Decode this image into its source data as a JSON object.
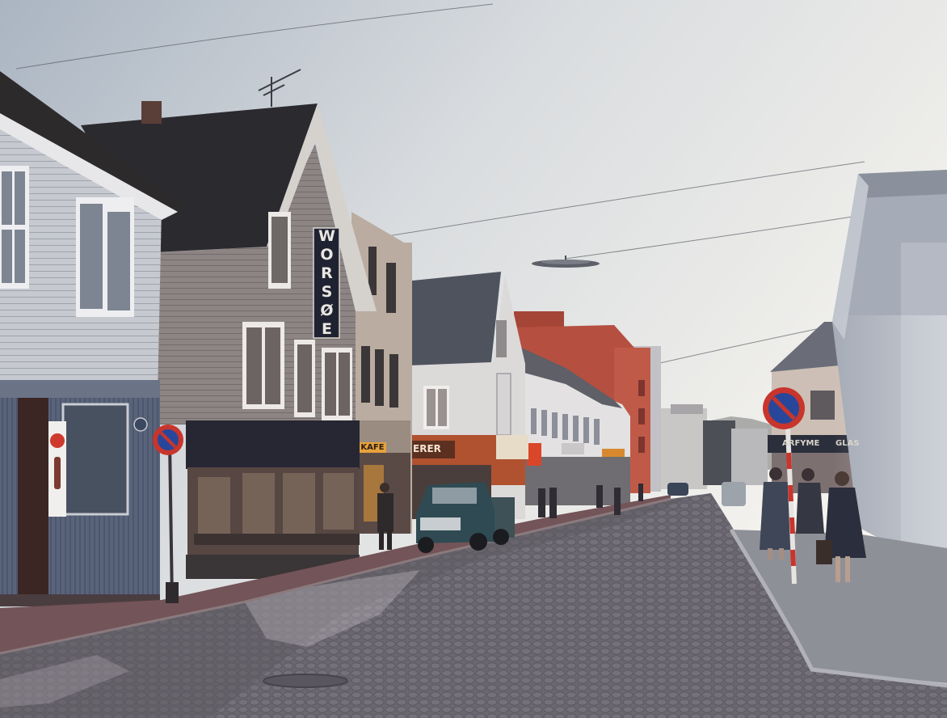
{
  "signs": {
    "worsoe": "WORSØE",
    "kafe": "KAFE",
    "shop_erer": "ERER",
    "parfyme": "ARFYME",
    "glas": "GLAS"
  },
  "colors": {
    "sky_top": "#aeb8c3",
    "sky_bright": "#f6f4ee",
    "cobblestone": "#6e6a72",
    "sidewalk_left": "#735458",
    "sidewalk_right": "#8e9097",
    "no_parking_red": "#c8352c",
    "no_parking_blue": "#28479a",
    "red_building": "#b54f40"
  },
  "icons": {
    "no_parking_sign": "no-parking-sign-icon",
    "coca_cola_sign": "coca-cola-sign-icon"
  }
}
